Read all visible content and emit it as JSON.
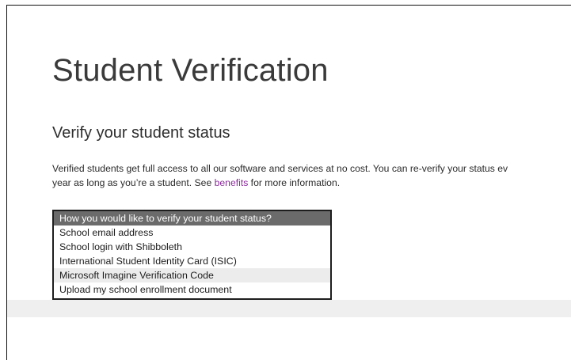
{
  "page": {
    "title": "Student Verification",
    "section_title": "Verify your student status",
    "description": {
      "line1": "Verified students get full access to all our software and services at no cost. You can re-verify your status ev",
      "line2_before": "year as long as you’re a student. See ",
      "link_text": "benefits",
      "line2_after": " for more information."
    }
  },
  "verification_select": {
    "options": [
      {
        "label": "How you would like to verify your student status?",
        "state": "selected"
      },
      {
        "label": "School email address",
        "state": "normal"
      },
      {
        "label": "School login with Shibboleth",
        "state": "normal"
      },
      {
        "label": "International Student Identity Card (ISIC)",
        "state": "normal"
      },
      {
        "label": "Microsoft Imagine Verification Code",
        "state": "hovered"
      },
      {
        "label": "Upload my school enrollment document",
        "state": "normal"
      }
    ]
  },
  "colors": {
    "link": "#8a2c9a",
    "selected_option_bg": "#6b6b6b",
    "hovered_option_bg": "#ececec"
  }
}
